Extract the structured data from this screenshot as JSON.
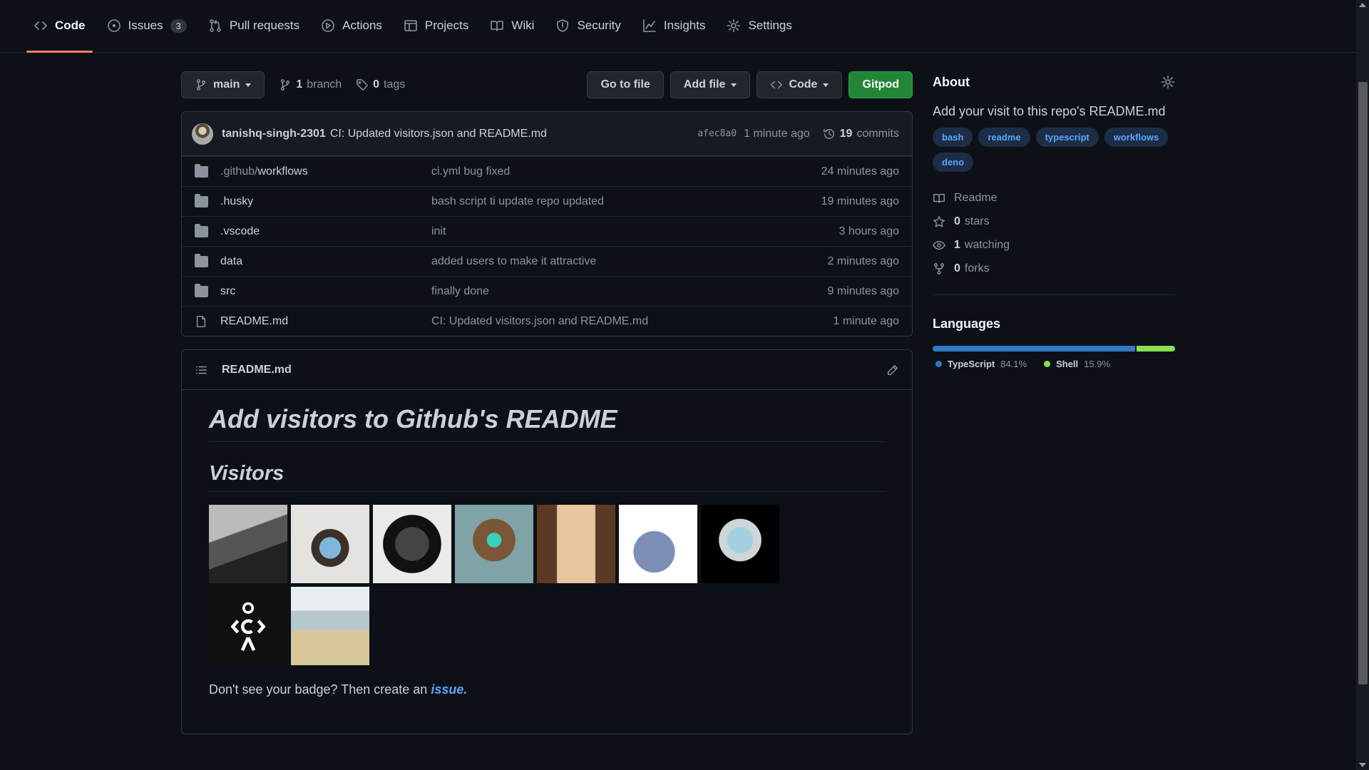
{
  "nav": {
    "items": [
      {
        "label": "Code",
        "icon": "code-icon",
        "active": true
      },
      {
        "label": "Issues",
        "icon": "issue-opened-icon",
        "count": "3"
      },
      {
        "label": "Pull requests",
        "icon": "git-pull-request-icon"
      },
      {
        "label": "Actions",
        "icon": "play-icon"
      },
      {
        "label": "Projects",
        "icon": "table-icon"
      },
      {
        "label": "Wiki",
        "icon": "book-icon"
      },
      {
        "label": "Security",
        "icon": "shield-icon"
      },
      {
        "label": "Insights",
        "icon": "graph-icon"
      },
      {
        "label": "Settings",
        "icon": "gear-icon"
      }
    ]
  },
  "toolbar": {
    "branch": "main",
    "branches_count": "1",
    "branches_label": "branch",
    "tags_count": "0",
    "tags_label": "tags",
    "go_to_file": "Go to file",
    "add_file": "Add file",
    "code": "Code",
    "gitpod": "Gitpod"
  },
  "commit": {
    "author": "tanishq-singh-2301",
    "message": "CI: Updated visitors.json and README.md",
    "sha": "afec8a0",
    "time": "1 minute ago",
    "commits_count": "19",
    "commits_label": "commits"
  },
  "files": [
    {
      "type": "dir",
      "name_dim": ".github/",
      "name": "workflows",
      "commit": "ci.yml bug fixed",
      "age": "24 minutes ago"
    },
    {
      "type": "dir",
      "name_dim": "",
      "name": ".husky",
      "commit": "bash script ti update repo updated",
      "age": "19 minutes ago"
    },
    {
      "type": "dir",
      "name_dim": "",
      "name": ".vscode",
      "commit": "init",
      "age": "3 hours ago"
    },
    {
      "type": "dir",
      "name_dim": "",
      "name": "data",
      "commit": "added users to make it attractive",
      "age": "2 minutes ago"
    },
    {
      "type": "dir",
      "name_dim": "",
      "name": "src",
      "commit": "finally done",
      "age": "9 minutes ago"
    },
    {
      "type": "file",
      "name_dim": "",
      "name": "README.md",
      "commit": "CI: Updated visitors.json and README.md",
      "age": "1 minute ago"
    }
  ],
  "readme": {
    "filename": "README.md",
    "h1": "Add visitors to Github's README",
    "h2": "Visitors",
    "footer_text": "Don't see your badge? Then create an ",
    "footer_link": "issue."
  },
  "about": {
    "title": "About",
    "description": "Add your visit to this repo's README.md",
    "topics": [
      "bash",
      "readme",
      "typescript",
      "workflows",
      "deno"
    ],
    "readme_label": "Readme",
    "stars_count": "0",
    "stars_label": "stars",
    "watching_count": "1",
    "watching_label": "watching",
    "forks_count": "0",
    "forks_label": "forks"
  },
  "languages": {
    "title": "Languages",
    "items": [
      {
        "name": "TypeScript",
        "percent": "84.1%",
        "share": 84.1,
        "color": "#3178c6"
      },
      {
        "name": "Shell",
        "percent": "15.9%",
        "share": 15.9,
        "color": "#89e051"
      }
    ]
  }
}
